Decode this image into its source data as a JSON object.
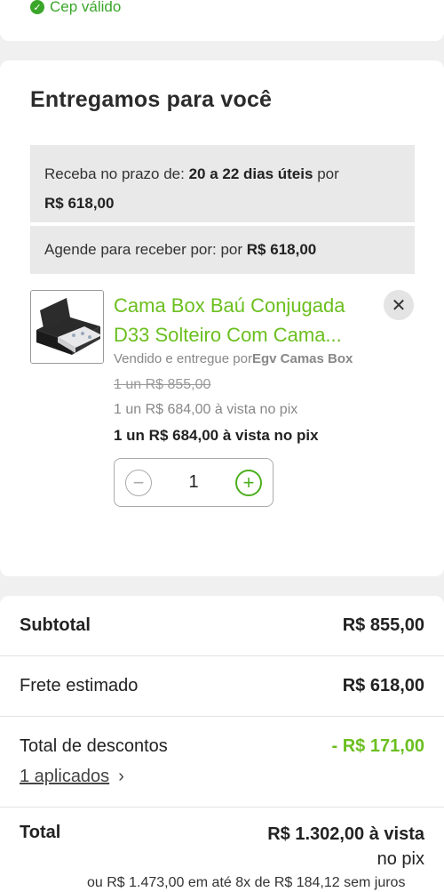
{
  "cep": {
    "status": "Cep válido"
  },
  "delivery": {
    "title": "Entregamos para você",
    "prazo_prefix": "Receba no prazo de:",
    "prazo_days": "20 a 22 dias úteis",
    "prazo_suffix": "por",
    "prazo_price": "R$ 618,00",
    "agende_prefix": "Agende para receber por: por",
    "agende_price": "R$ 618,00"
  },
  "product": {
    "name": "Cama Box Baú Conjugada D33 Solteiro Com Cama...",
    "seller_prefix": "Vendido e entregue por",
    "seller_name": "Egv Camas Box",
    "old_price": "1 un R$ 855,00",
    "pix_price_gray": "1 un R$ 684,00 à vista no pix",
    "pix_price_bold": "1 un R$ 684,00 à vista no pix",
    "quantity": "1",
    "image_icon": "bed-product-image"
  },
  "summary": {
    "subtotal_label": "Subtotal",
    "subtotal_value": "R$ 855,00",
    "frete_label": "Frete estimado",
    "frete_value": "R$ 618,00",
    "descontos_label": "Total de descontos",
    "descontos_value": "- R$ 171,00",
    "aplicados_link": "1 aplicados",
    "total_label": "Total",
    "total_value_line1": "R$ 1.302,00 à vista",
    "total_value_line2": "no pix",
    "installments": "ou R$ 1.473,00 em até 8x de R$ 184,12 sem juros"
  },
  "colors": {
    "accent_green": "#6bbf1f",
    "check_green": "#3aa629"
  }
}
